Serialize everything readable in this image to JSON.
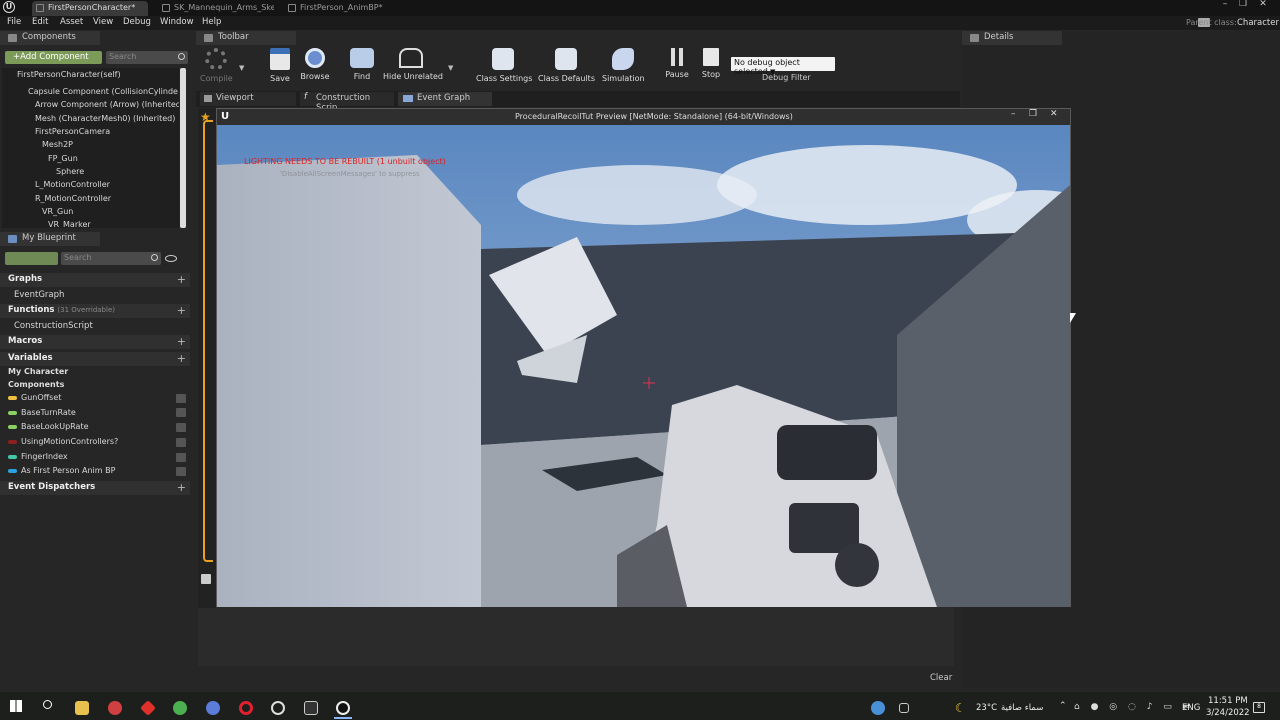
{
  "tabs": [
    {
      "label": "FirstPersonCharacter*",
      "active": true
    },
    {
      "label": "SK_Mannequin_Arms_Ske",
      "active": false
    },
    {
      "label": "FirstPerson_AnimBP*",
      "active": false
    }
  ],
  "parent_class": {
    "label": "Parent class:",
    "value": "Character"
  },
  "menu": [
    "File",
    "Edit",
    "Asset",
    "View",
    "Debug",
    "Window",
    "Help"
  ],
  "components": {
    "title": "Components",
    "add_label": "+Add Component",
    "search_placeholder": "Search",
    "items": [
      "FirstPersonCharacter(self)",
      "Capsule Component (CollisionCylinder) (Ir",
      "Arrow Component (Arrow) (Inherited)",
      "Mesh (CharacterMesh0) (Inherited)",
      "FirstPersonCamera",
      "Mesh2P",
      "FP_Gun",
      "Sphere",
      "L_MotionController",
      "R_MotionController",
      "VR_Gun",
      "VR_Marker"
    ]
  },
  "blueprint": {
    "title": "My Blueprint",
    "search_placeholder": "Search",
    "graphs_label": "Graphs",
    "event_graph": "EventGraph",
    "functions_label": "Functions",
    "functions_count": "(31 Overridable)",
    "construction": "ConstructionScript",
    "macros_label": "Macros",
    "variables_label": "Variables",
    "my_character": "My Character",
    "components_label": "Components",
    "variables": [
      "GunOffset",
      "BaseTurnRate",
      "BaseLookUpRate",
      "UsingMotionControllers?",
      "FingerIndex",
      "As First Person Anim BP"
    ],
    "dispatchers_label": "Event Dispatchers"
  },
  "toolbar": {
    "title": "Toolbar",
    "compile": "Compile",
    "save": "Save",
    "browse": "Browse",
    "find": "Find",
    "hide_unrelated": "Hide Unrelated",
    "class_settings": "Class Settings",
    "class_defaults": "Class Defaults",
    "simulation": "Simulation",
    "pause": "Pause",
    "stop": "Stop",
    "debug_select": "No debug object selected",
    "debug_filter": "Debug Filter"
  },
  "editor_tabs": [
    "Viewport",
    "Construction Scrip",
    "Event Graph"
  ],
  "details": {
    "title": "Details"
  },
  "preview": {
    "title": "ProceduralRecoilTut Preview [NetMode: Standalone]  (64-bit/Windows)",
    "warning": "LIGHTING NEEDS TO BE REBUILT (1 unbuilt object)",
    "warning_sub": "'DisableAllScreenMessages' to suppress"
  },
  "clear_label": "Clear",
  "taskbar": {
    "weather": "23°C",
    "weather_desc": "سماء صافية",
    "lang": "ENG",
    "time": "11:51 PM",
    "date": "3/24/2022",
    "notif": "8"
  },
  "colors": {
    "accent": "#f0a020",
    "float_pill": "#88d160",
    "bool_pill": "#8c2020",
    "int_pill": "#40c8a8",
    "obj_pill": "#2aa3e0"
  }
}
